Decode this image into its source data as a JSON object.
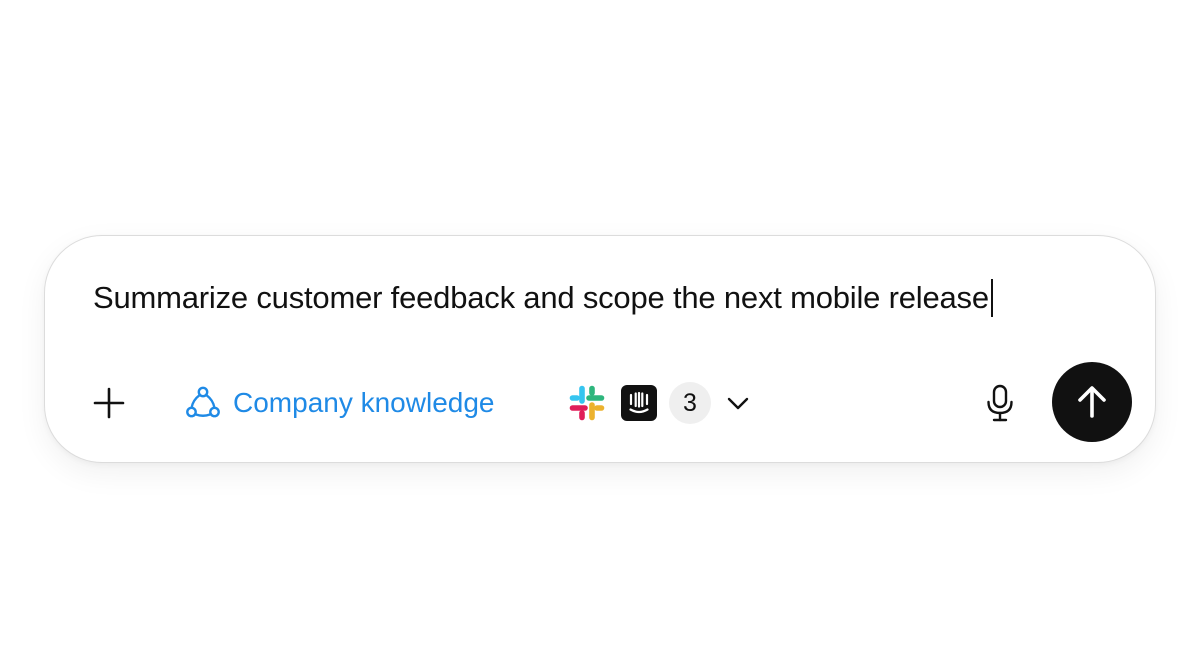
{
  "composer": {
    "prompt_text": "Summarize customer feedback and scope the next mobile release",
    "add_icon": "plus-icon",
    "knowledge": {
      "icon": "triangle-nodes-icon",
      "label": "Company knowledge",
      "color": "#1f8ae6"
    },
    "sources": {
      "apps": [
        "slack-icon",
        "intercom-icon"
      ],
      "more_count": "3",
      "chevron_icon": "chevron-down-icon"
    },
    "mic_icon": "microphone-icon",
    "send_icon": "arrow-up-icon",
    "send_color": "#111111"
  }
}
